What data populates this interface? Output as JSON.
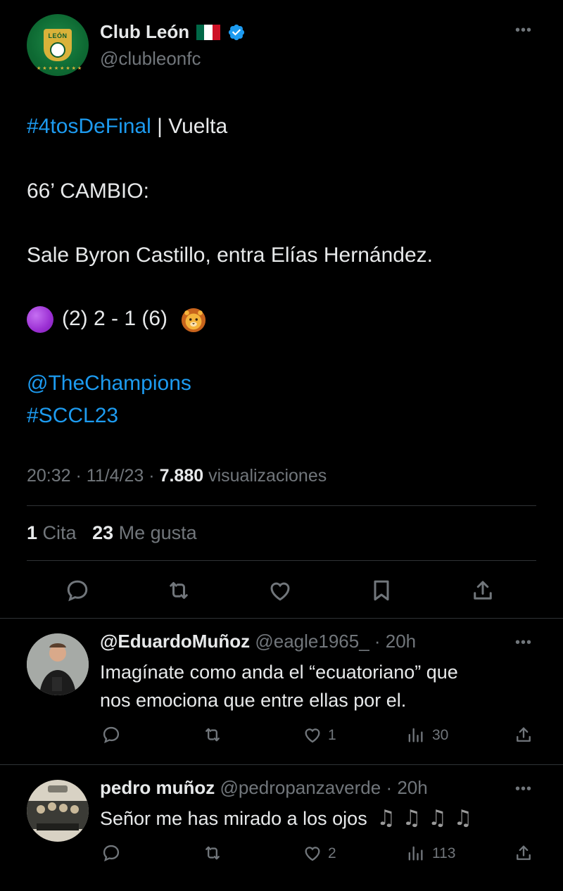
{
  "tweet": {
    "author_name": "Club León",
    "author_handle": "@clubleonfc",
    "hashtag1": "#4tosDeFinal",
    "title_rest": " | Vuelta",
    "line2": "66’ CAMBIO:",
    "line3": "Sale Byron Castillo, entra Elías Hernández.",
    "score": "(2) 2 - 1 (6)",
    "mention": "@TheChampions",
    "hashtag2": "#SCCL23",
    "time": "20:32",
    "date": "11/4/23",
    "views": "7.880",
    "views_label": "visualizaciones",
    "quotes": "1",
    "quotes_label": "Cita",
    "likes": "23",
    "likes_label": "Me gusta"
  },
  "replies": [
    {
      "name": "@EduardoMuñoz",
      "handle": "@eagle1965_",
      "time": "20h",
      "text_line1": "Imagínate como anda el “ecuatoriano” que",
      "text_line2": "nos emociona que entre ellas por el.",
      "likes": "1",
      "views": "30"
    },
    {
      "name": "pedro muñoz",
      "handle": "@pedropanzaverde",
      "time": "20h",
      "text": "Señor me has mirado a los ojos",
      "likes": "2",
      "views": "113"
    }
  ],
  "icons": {
    "reply": "reply-icon",
    "retweet": "retweet-icon",
    "like": "heart-icon",
    "bookmark": "bookmark-icon",
    "share": "share-icon",
    "views": "views-icon",
    "more": "more-icon",
    "verified": "verified-badge-icon",
    "flag": "mexico-flag-icon"
  },
  "colors": {
    "background": "#000000",
    "text": "#e7e9ea",
    "secondary": "#71767b",
    "link": "#1d9bf0",
    "divider": "#2f3336"
  }
}
